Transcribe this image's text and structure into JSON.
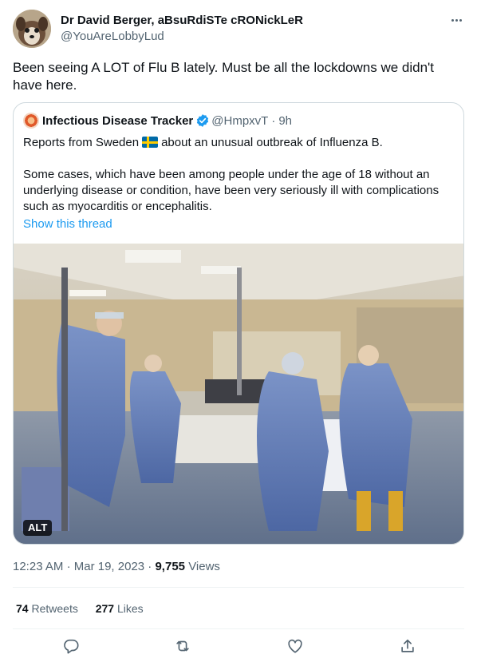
{
  "author": {
    "display_name": "Dr David Berger, aBsuRdiSTe cRONickLeR",
    "handle": "@YouAreLobbyLud"
  },
  "tweet": {
    "text": "Been seeing A LOT of Flu B lately. Must be all the lockdowns we didn't have here."
  },
  "quoted": {
    "name": "Infectious Disease Tracker",
    "handle": "@HmpxvT",
    "separator": "·",
    "time": "9h",
    "line1_before": "Reports from Sweden",
    "line1_after": "about an unusual outbreak of Influenza B.",
    "paragraph2": "Some cases, which have been among people under the age of 18 without an underlying disease or condition, have been very seriously ill with complications such as myocarditis or encephalitis.",
    "show_thread": "Show this thread",
    "alt_badge": "ALT"
  },
  "meta": {
    "time": "12:23 AM",
    "sep1": "·",
    "date": "Mar 19, 2023",
    "sep2": "·",
    "views_count": "9,755",
    "views_label": "Views"
  },
  "stats": {
    "retweets_count": "74",
    "retweets_label": "Retweets",
    "likes_count": "277",
    "likes_label": "Likes"
  },
  "colors": {
    "accent": "#1d9bf0",
    "secondary_text": "#536471",
    "border": "#cfd9de"
  },
  "icons": [
    "more-icon",
    "verified-badge-icon",
    "sweden-flag-icon",
    "reply-icon",
    "retweet-icon",
    "like-icon",
    "share-icon"
  ]
}
